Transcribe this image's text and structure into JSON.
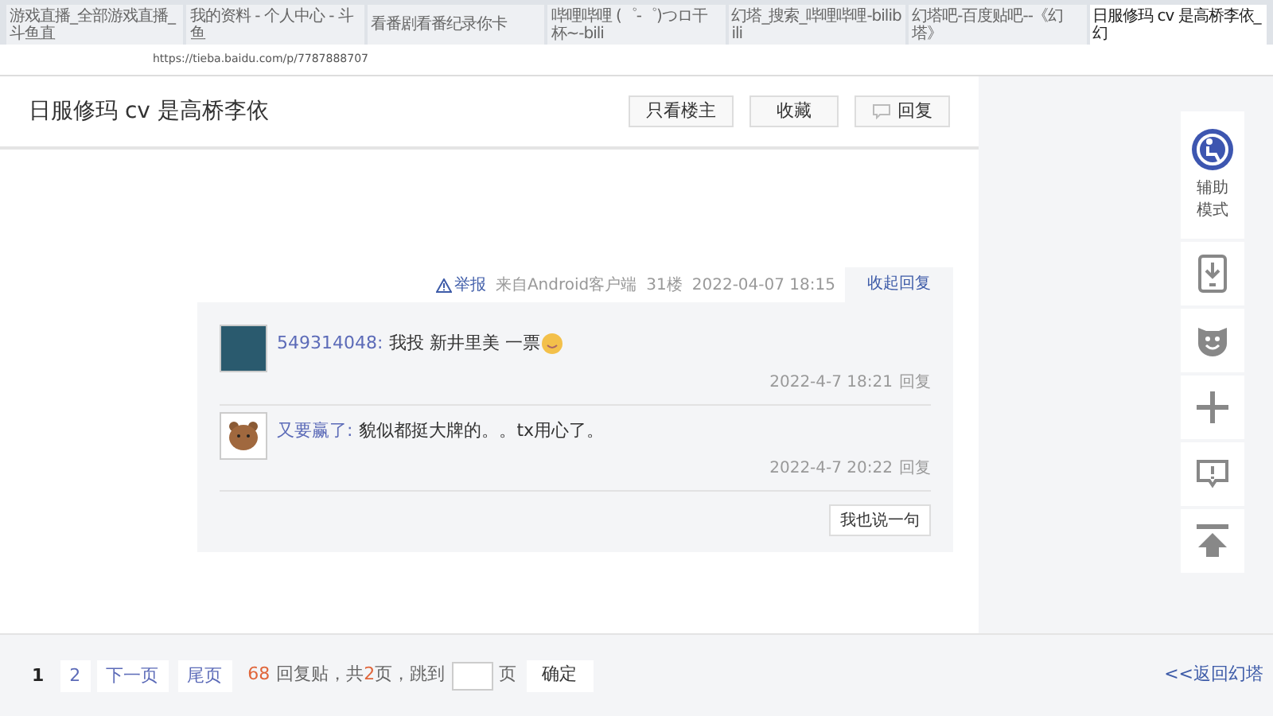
{
  "browser": {
    "tabs": [
      {
        "title": "游戏直播_全部游戏直播_斗鱼直",
        "selected": false
      },
      {
        "title": "我的资料 - 个人中心 - 斗鱼",
        "selected": false
      },
      {
        "title": "看番剧看番纪录你卡",
        "selected": false
      },
      {
        "title": "哔哩哔哩 (゜-゜)つロ干杯~-bili",
        "selected": false
      },
      {
        "title": "幻塔_搜索_哔哩哔哩-bilibili",
        "selected": false
      },
      {
        "title": "幻塔吧-百度贴吧--《幻塔》",
        "selected": false
      },
      {
        "title": "日服修玛 cv 是高桥李依_幻",
        "selected": true
      }
    ],
    "url": "https://tieba.baidu.com/p/7787888707"
  },
  "thread": {
    "title": "日服修玛 cv 是高桥李依",
    "buttons": [
      {
        "label": "只看楼主",
        "kind": "plain"
      },
      {
        "label": "收藏",
        "kind": "plain"
      },
      {
        "label": "回复",
        "kind": "reply"
      }
    ]
  },
  "post_meta": {
    "report": "举报",
    "source": "来自Android客户端",
    "floor": "31楼",
    "time": "2022-04-07 18:15",
    "toggle": "收起回复"
  },
  "replies": [
    {
      "user": "549314048:",
      "text": "我投 新井里美 一票",
      "emoji": true,
      "avatar": {
        "kind": "photo"
      },
      "time": "2022-4-7 18:21",
      "reply": "回复"
    },
    {
      "user": "又要赢了:",
      "text": "貌似都挺大牌的。。tx用心了。",
      "emoji": false,
      "avatar": {
        "kind": "bear"
      },
      "time": "2022-4-7 20:22",
      "reply": "回复"
    }
  ],
  "say_button": "我也说一句",
  "pagination": {
    "pages": [
      {
        "label": "1",
        "selected": true
      },
      {
        "label": "2",
        "selected": false
      }
    ],
    "next": "下一页",
    "last": "尾页",
    "count": "68",
    "count_text": "回复贴，共",
    "total": "2",
    "total_text": "页，跳到",
    "page_unit": "页",
    "confirm": "确定",
    "back": "<<返回幻塔"
  },
  "sidebar": {
    "assist": "辅助模式",
    "tools": [
      {
        "kind": "phone"
      },
      {
        "kind": "face"
      },
      {
        "kind": "plus"
      },
      {
        "kind": "alert"
      },
      {
        "kind": "top"
      }
    ]
  }
}
